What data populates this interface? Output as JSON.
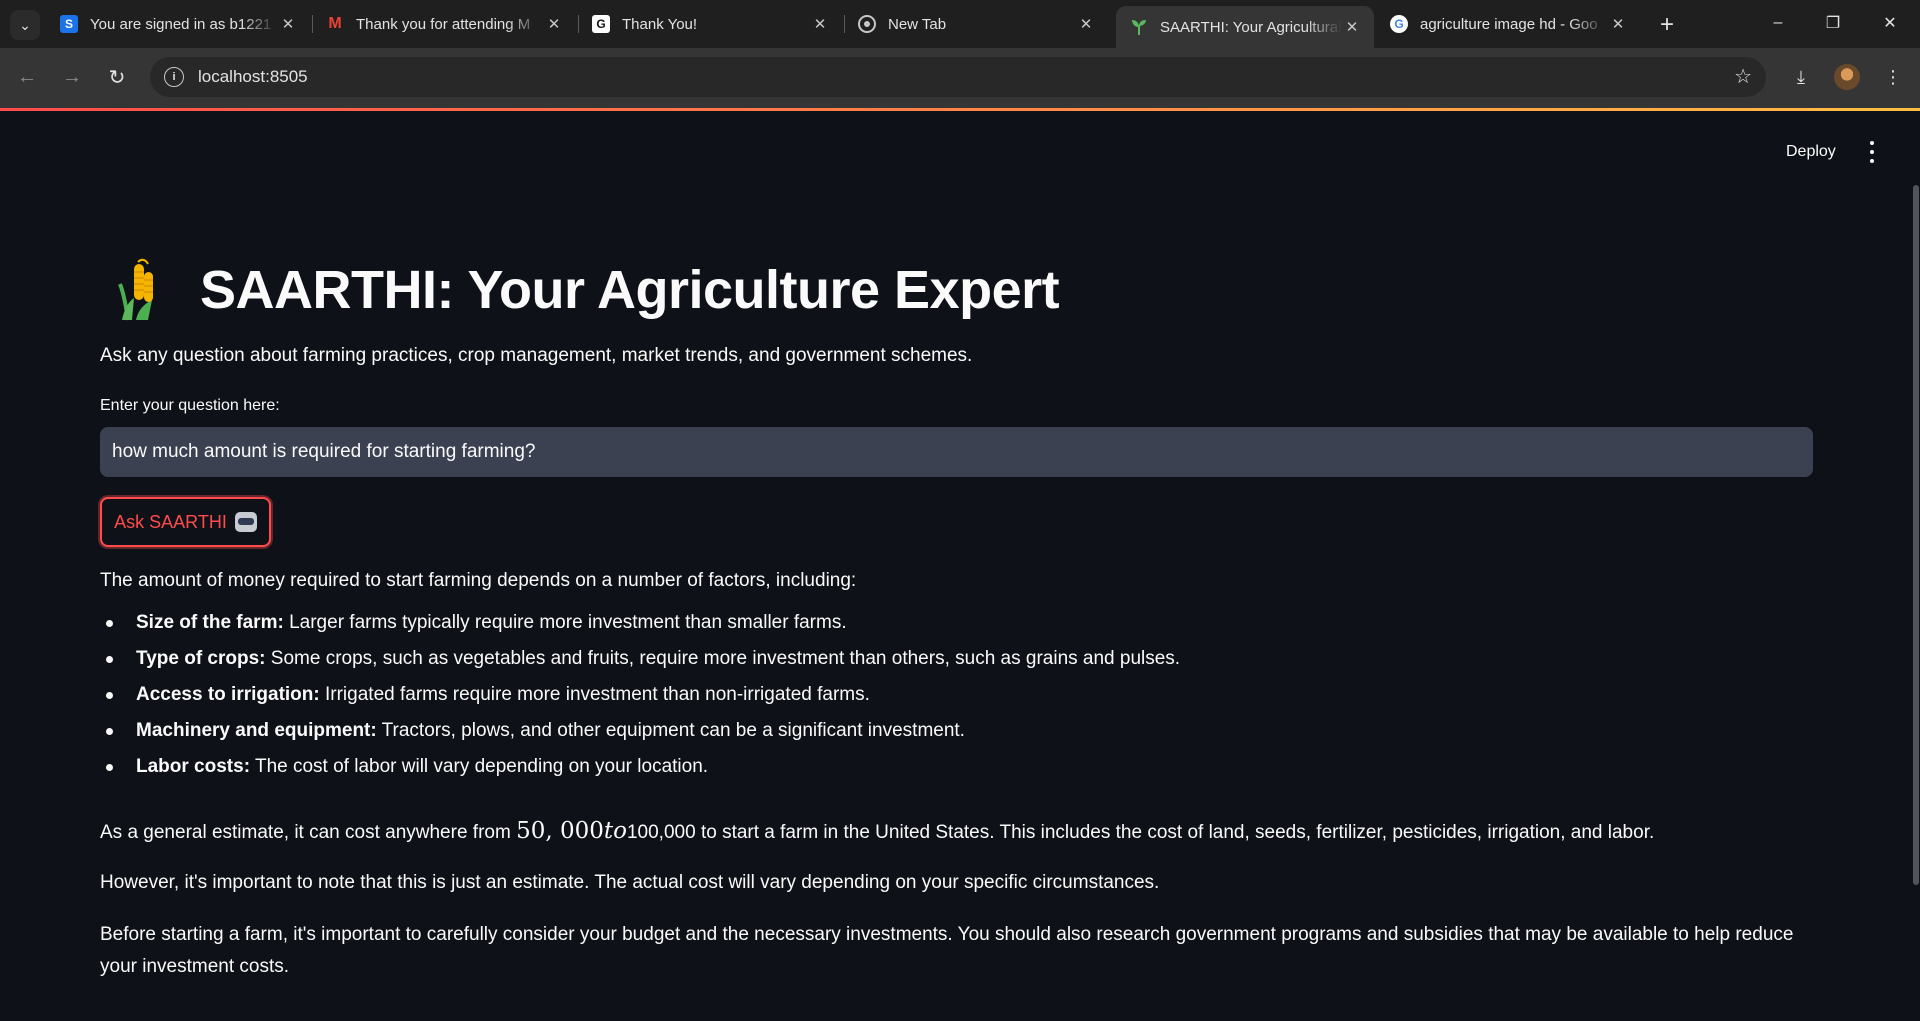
{
  "browser": {
    "tabs": [
      {
        "title": "You are signed in as b1221",
        "favicon": "s-icon",
        "active": false
      },
      {
        "title": "Thank you for attending M",
        "favicon": "gmail-icon",
        "active": false
      },
      {
        "title": "Thank You!",
        "favicon": "g-icon",
        "active": false
      },
      {
        "title": "New Tab",
        "favicon": "chrome-icon",
        "active": false
      },
      {
        "title": "SAARTHI: Your Agricultural",
        "favicon": "sprout-icon",
        "active": true
      },
      {
        "title": "agriculture image hd - Goo",
        "favicon": "google-icon",
        "active": false
      }
    ],
    "url": "localhost:8505"
  },
  "header": {
    "deploy_label": "Deploy"
  },
  "page": {
    "title": "SAARTHI: Your Agriculture Expert",
    "subtitle": "Ask any question about farming practices, crop management, market trends, and government schemes.",
    "input_label": "Enter your question here:",
    "question_value": "how much amount is required for starting farming?",
    "ask_button_label": "Ask SAARTHI"
  },
  "answer": {
    "intro": "The amount of money required to start farming depends on a number of factors, including:",
    "factors": [
      {
        "term": "Size of the farm:",
        "text": "Larger farms typically require more investment than smaller farms."
      },
      {
        "term": "Type of crops:",
        "text": "Some crops, such as vegetables and fruits, require more investment than others, such as grains and pulses."
      },
      {
        "term": "Access to irrigation:",
        "text": "Irrigated farms require more investment than non-irrigated farms."
      },
      {
        "term": "Machinery and equipment:",
        "text": "Tractors, plows, and other equipment can be a significant investment."
      },
      {
        "term": "Labor costs:",
        "text": "The cost of labor will vary depending on your location."
      }
    ],
    "estimate_prefix": "As a general estimate, it can cost anywhere from ",
    "estimate_math_num": "50, 000",
    "estimate_math_to": "to",
    "estimate_suffix": "100,000 to start a farm in the United States. This includes the cost of land, seeds, fertilizer, pesticides, irrigation, and labor.",
    "caveat": "However, it's important to note that this is just an estimate. The actual cost will vary depending on your specific circumstances.",
    "closing": "Before starting a farm, it's important to carefully consider your budget and the necessary investments. You should also research government programs and subsidies that may be available to help reduce your investment costs."
  },
  "colors": {
    "background": "#0e1117",
    "accent": "#ff4b4b",
    "input_bg": "#3b4150"
  }
}
